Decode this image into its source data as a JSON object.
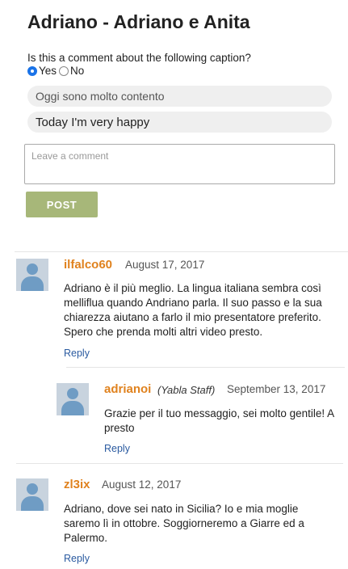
{
  "header": {
    "title": "Adriano - Adriano e Anita"
  },
  "form": {
    "question": "Is this a comment about the following caption?",
    "options": [
      {
        "label": "Yes",
        "checked": true
      },
      {
        "label": "No",
        "checked": false
      }
    ],
    "caption_italian": "Oggi sono molto contento",
    "caption_english": "Today I'm very happy",
    "comment_placeholder": "Leave a comment",
    "post_label": "POST"
  },
  "comments": [
    {
      "user": "ilfalco60",
      "date": "August 17, 2017",
      "text": "Adriano è il più meglio. La lingua italiana sembra così melliflua quando Andriano parla. Il suo passo e la sua chiarezza aiutano a farlo il mio presentatore preferito. Spero che prenda molti altri video presto.",
      "reply_label": "Reply"
    },
    {
      "user": "adrianoi",
      "staff_tag": "(Yabla Staff)",
      "date": "September 13, 2017",
      "text": "Grazie per il tuo messaggio, sei molto gentile! A presto",
      "reply_label": "Reply"
    },
    {
      "user": "zl3ix",
      "date": "August 12, 2017",
      "text": "Adriano, dove sei nato in Sicilia? Io e mia moglie saremo lì in ottobre. Soggiorneremo a Giarre ed a Palermo.",
      "reply_label": "Reply"
    }
  ],
  "colors": {
    "username": "#e0821e",
    "post_button": "#a7b779",
    "link": "#2a5aa0",
    "avatar": "#6f9cc4"
  },
  "icons": {
    "avatar": "user-avatar-icon"
  }
}
